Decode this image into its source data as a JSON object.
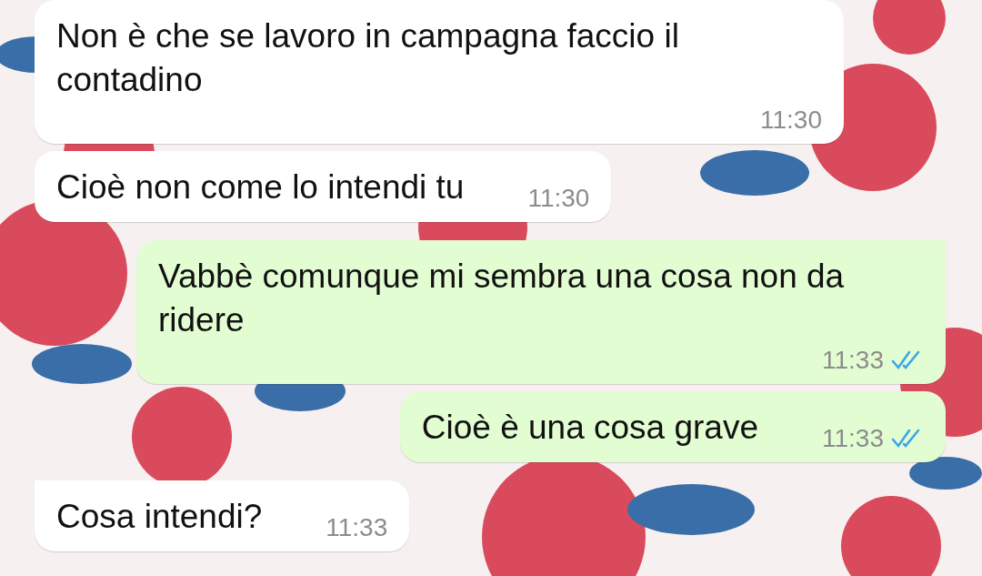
{
  "messages": [
    {
      "kind": "incoming",
      "text": "Non è che se lavoro in campagna faccio il contadino",
      "time": "11:30",
      "tail": false
    },
    {
      "kind": "incoming",
      "text": "Cioè non come lo intendi tu",
      "time": "11:30",
      "tail": false
    },
    {
      "kind": "outgoing",
      "text": "Vabbè comunque mi sembra una cosa non da ridere",
      "time": "11:33",
      "tail": true,
      "read": true
    },
    {
      "kind": "outgoing",
      "text": "Cioè è una cosa grave",
      "time": "11:33",
      "tail": false,
      "read": true
    },
    {
      "kind": "incoming",
      "text": "Cosa intendi?",
      "time": "11:33",
      "tail": true
    }
  ]
}
